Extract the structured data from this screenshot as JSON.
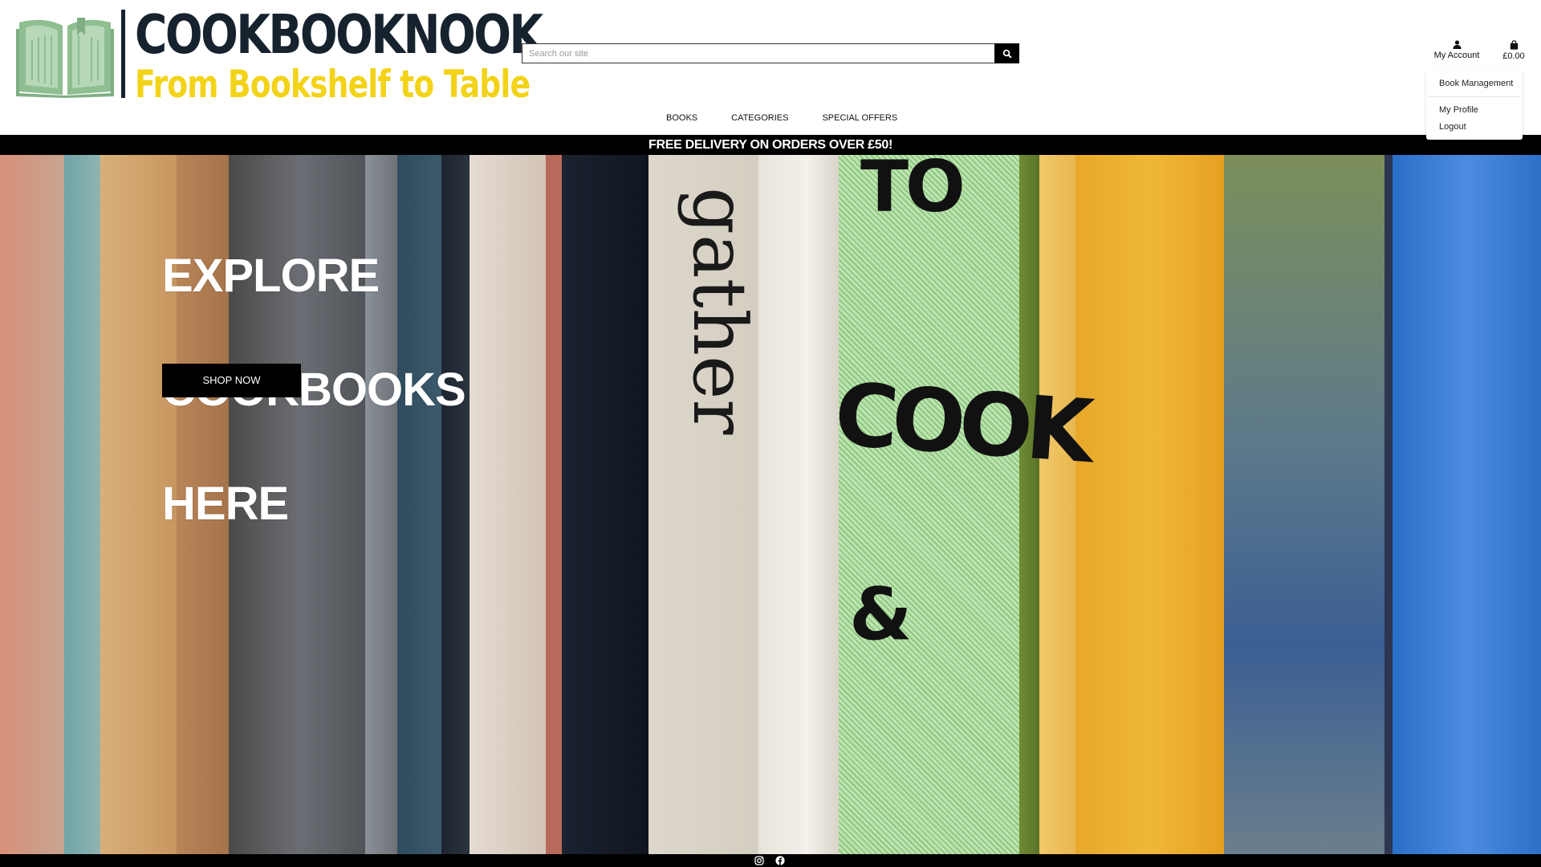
{
  "brand": {
    "name": "COOKBOOKNOOK",
    "tagline": "From Bookshelf to Table",
    "colors": {
      "name": "#17222f",
      "tagline": "#f2d318",
      "book_icon": "#8fbe91"
    }
  },
  "search": {
    "placeholder": "Search our site",
    "icon": "search-icon"
  },
  "account": {
    "label": "My Account",
    "icon": "user-icon"
  },
  "cart": {
    "total": "£0.00",
    "icon": "shopping-bag-icon"
  },
  "account_dropdown": {
    "items": [
      "Book Management",
      "My Profile",
      "Logout"
    ]
  },
  "nav": {
    "items": [
      "BOOKS",
      "CATEGORIES",
      "SPECIAL OFFERS"
    ]
  },
  "delivery_banner": "FREE DELIVERY ON ORDERS OVER £50!",
  "hero": {
    "title_lines": [
      "EXPLORE",
      "COOKBOOKS",
      "HERE"
    ],
    "cta": "SHOP NOW",
    "spine_texts": [
      "gather",
      "TO",
      "COOK",
      "&"
    ]
  },
  "footer": {
    "social_icons": [
      "instagram-icon",
      "facebook-icon"
    ]
  }
}
